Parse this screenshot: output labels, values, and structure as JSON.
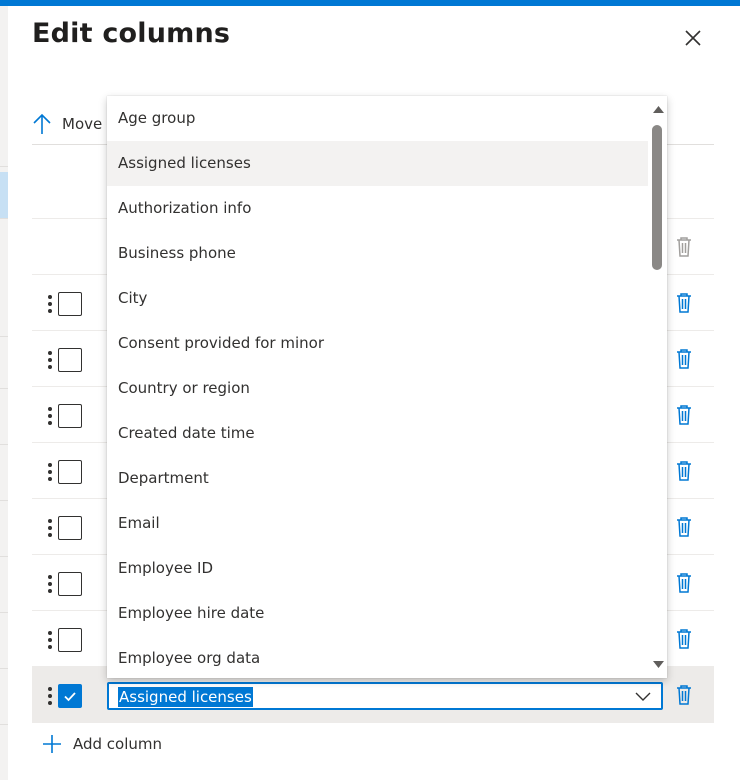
{
  "panel": {
    "title": "Edit columns",
    "move_up_label": "Move up",
    "add_column_label": "Add column"
  },
  "rows": [
    {
      "checked": false
    },
    {
      "checked": false
    },
    {
      "checked": false
    },
    {
      "checked": false
    },
    {
      "checked": false
    },
    {
      "checked": false
    },
    {
      "checked": false
    },
    {
      "checked": true,
      "selected_value": "Assigned licenses"
    }
  ],
  "dropdown": {
    "hover_index": 1,
    "options": [
      "Age group",
      "Assigned licenses",
      "Authorization info",
      "Business phone",
      "City",
      "Consent provided for minor",
      "Country or region",
      "Created date time",
      "Department",
      "Email",
      "Employee ID",
      "Employee hire date",
      "Employee org data"
    ]
  },
  "colors": {
    "accent": "#0078d4",
    "text": "#323130",
    "hover": "#f3f2f1"
  },
  "icons": [
    "close-icon",
    "arrow-up-icon",
    "drag-handle-icon",
    "trash-icon",
    "check-icon",
    "chevron-down-icon",
    "plus-icon",
    "scroll-up-arrow-icon",
    "scroll-down-arrow-icon"
  ]
}
